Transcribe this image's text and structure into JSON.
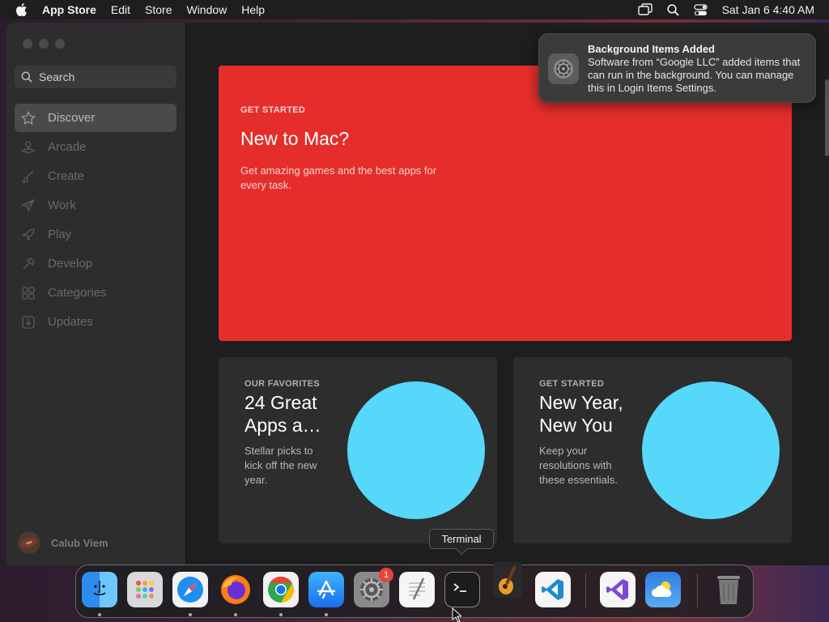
{
  "menubar": {
    "app_name": "App Store",
    "items": [
      "Edit",
      "Store",
      "Window",
      "Help"
    ],
    "datetime": "Sat Jan 6  4:40 AM"
  },
  "sidebar": {
    "search_placeholder": "Search",
    "items": [
      {
        "label": "Discover",
        "icon": "star-icon"
      },
      {
        "label": "Arcade",
        "icon": "joystick-icon"
      },
      {
        "label": "Create",
        "icon": "brush-icon"
      },
      {
        "label": "Work",
        "icon": "paper-plane-icon"
      },
      {
        "label": "Play",
        "icon": "rocket-icon"
      },
      {
        "label": "Develop",
        "icon": "hammer-icon"
      },
      {
        "label": "Categories",
        "icon": "grid-icon"
      },
      {
        "label": "Updates",
        "icon": "download-icon"
      }
    ],
    "user_name": "Calub Viem"
  },
  "hero": {
    "eyebrow": "GET STARTED",
    "title": "New to Mac?",
    "description": "Get amazing games and the best apps for every task."
  },
  "cards": [
    {
      "eyebrow": "OUR FAVORITES",
      "title": "24 Great Apps a…",
      "description": "Stellar picks to kick off the new year."
    },
    {
      "eyebrow": "GET STARTED",
      "title": "New Year, New You",
      "description": "Keep your resolutions with these essentials."
    }
  ],
  "notification": {
    "title": "Background Items Added",
    "body": "Software from “Google LLC” added items that can run in the background. You can manage this in Login Items Settings."
  },
  "tooltip": "Terminal",
  "dock": {
    "apps": [
      "Finder",
      "Launchpad",
      "Safari",
      "Firefox",
      "Chrome",
      "App Store",
      "System Settings",
      "TextEdit",
      "Terminal",
      "GarageBand",
      "Visual Studio Code",
      "Visual Studio",
      "Weather",
      "Trash"
    ],
    "system_settings_badge": "1"
  },
  "colors": {
    "hero_bg": "#e52e2b",
    "circle": "#56d8fb",
    "badge": "#e9423c"
  }
}
